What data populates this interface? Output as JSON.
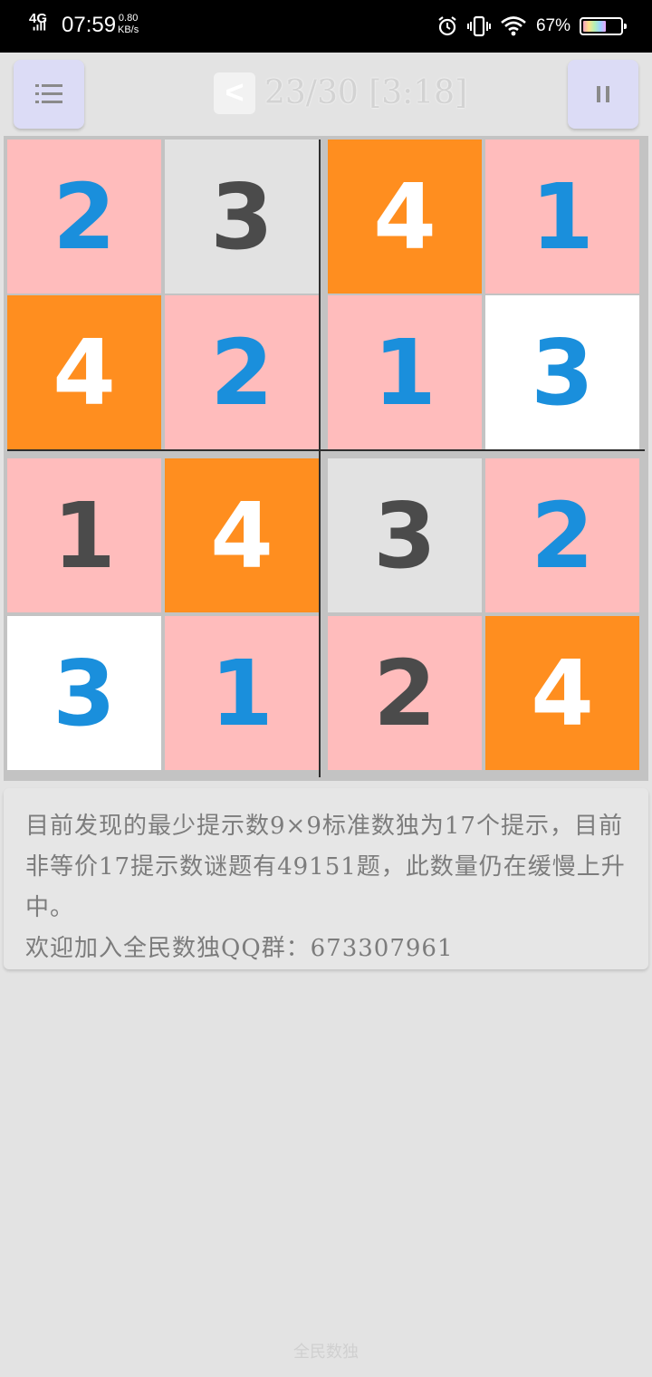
{
  "status_bar": {
    "network": "4G",
    "time": "07:59",
    "speed_value": "0.80",
    "speed_unit": "KB/s",
    "battery_percent": "67%",
    "battery_level": 0.67
  },
  "toolbar": {
    "back_label": "<",
    "progress": "23/30 [3:18]"
  },
  "board": {
    "cells": [
      {
        "value": "2",
        "bg": "#ffbcbc",
        "color": "#1a8fdc"
      },
      {
        "value": "3",
        "bg": "#e2e2e2",
        "color": "#4b4b4b"
      },
      {
        "value": "4",
        "bg": "#ff8e1f",
        "color": "#ffffff"
      },
      {
        "value": "1",
        "bg": "#ffbcbc",
        "color": "#1a8fdc"
      },
      {
        "value": "4",
        "bg": "#ff8e1f",
        "color": "#ffffff"
      },
      {
        "value": "2",
        "bg": "#ffbcbc",
        "color": "#1a8fdc"
      },
      {
        "value": "1",
        "bg": "#ffbcbc",
        "color": "#1a8fdc"
      },
      {
        "value": "3",
        "bg": "#ffffff",
        "color": "#1a8fdc"
      },
      {
        "value": "1",
        "bg": "#ffbcbc",
        "color": "#4b4b4b"
      },
      {
        "value": "4",
        "bg": "#ff8e1f",
        "color": "#ffffff"
      },
      {
        "value": "3",
        "bg": "#e2e2e2",
        "color": "#4b4b4b"
      },
      {
        "value": "2",
        "bg": "#ffbcbc",
        "color": "#1a8fdc"
      },
      {
        "value": "3",
        "bg": "#ffffff",
        "color": "#1a8fdc"
      },
      {
        "value": "1",
        "bg": "#ffbcbc",
        "color": "#1a8fdc"
      },
      {
        "value": "2",
        "bg": "#ffbcbc",
        "color": "#4b4b4b"
      },
      {
        "value": "4",
        "bg": "#ff8e1f",
        "color": "#ffffff"
      }
    ]
  },
  "info": {
    "paragraph": "目前发现的最少提示数9×9标准数独为17个提示，目前非等价17提示数谜题有49151题，此数量仍在缓慢上升中。",
    "qq_line": "欢迎加入全民数独QQ群：673307961"
  },
  "footer": {
    "app_name": "全民数独"
  },
  "colors": {
    "background": "#e3e3e3",
    "button_bg": "#dcdcf6",
    "button_icon": "#8a8a8a",
    "given_digit": "#4b4b4b",
    "entered_digit": "#1a8fdc",
    "highlight_orange": "#ff8e1f",
    "highlight_pink": "#ffbcbc"
  }
}
